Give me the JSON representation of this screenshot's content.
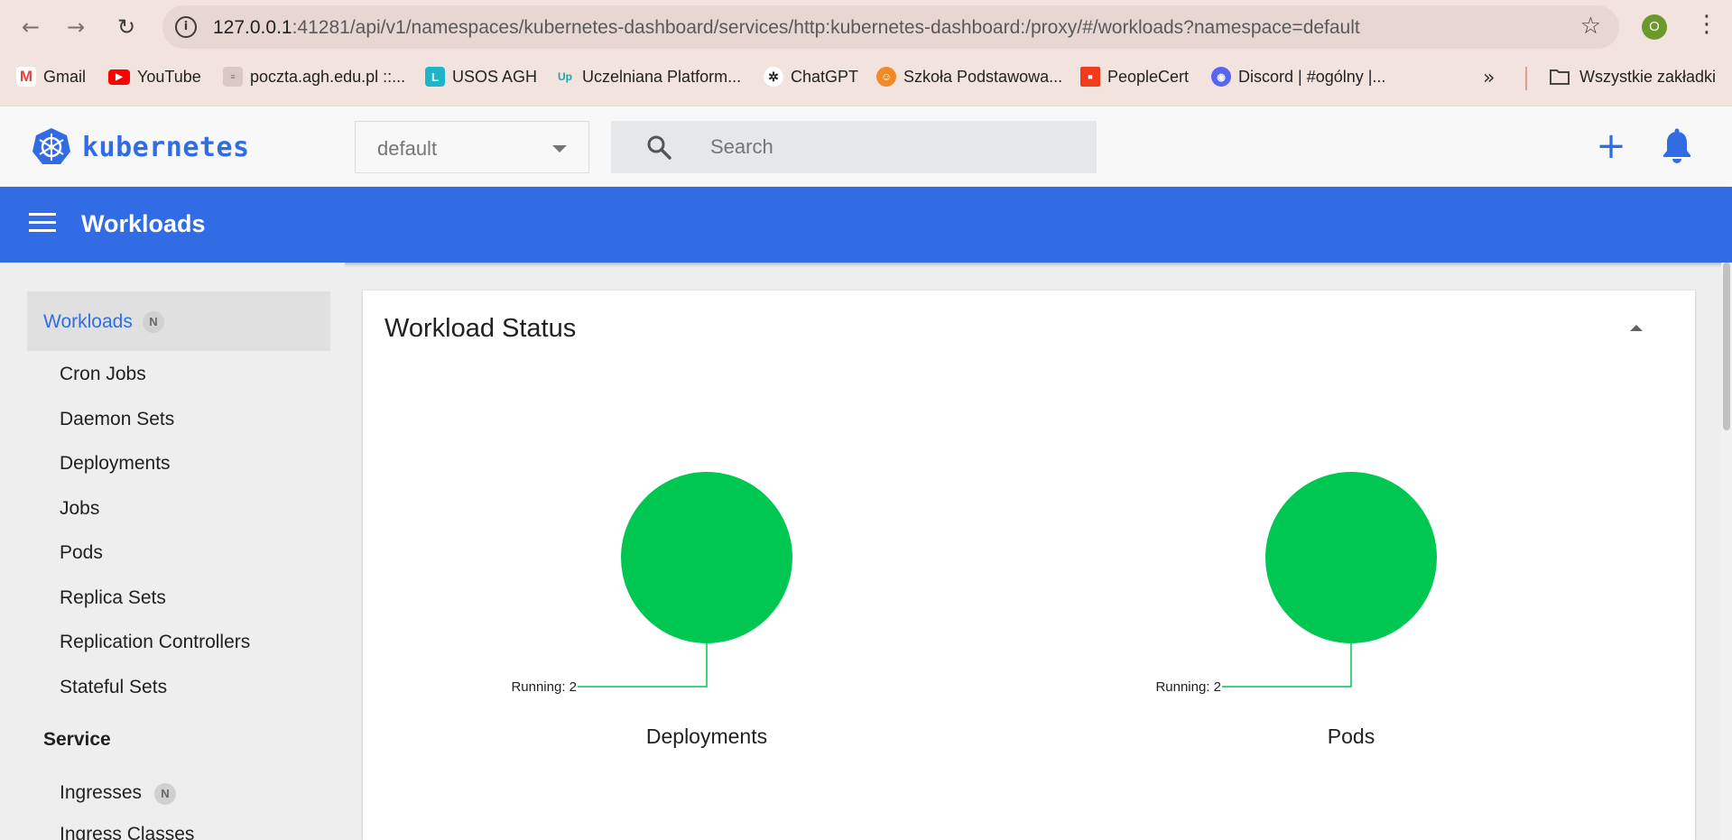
{
  "browser": {
    "url_host": "127.0.0.1",
    "url_rest": ":41281/api/v1/namespaces/kubernetes-dashboard/services/http:kubernetes-dashboard:/proxy/#/workloads?namespace=default",
    "profile_initial": "O",
    "bookmarks": [
      {
        "label": "Gmail",
        "icon": "gmail-icon",
        "color": "#ea4335"
      },
      {
        "label": "YouTube",
        "icon": "youtube-icon",
        "color": "#ff0000"
      },
      {
        "label": "poczta.agh.edu.pl ::...",
        "icon": "agh-mail-icon",
        "color": "#888888"
      },
      {
        "label": "USOS AGH",
        "icon": "usos-icon",
        "color": "#1fb5c9"
      },
      {
        "label": "Uczelniana Platform...",
        "icon": "upel-icon",
        "color": "#1aa6a6"
      },
      {
        "label": "ChatGPT",
        "icon": "chatgpt-icon",
        "color": "#222222"
      },
      {
        "label": "Szkoła Podstawowa...",
        "icon": "school-icon",
        "color": "#f08a24"
      },
      {
        "label": "PeopleCert",
        "icon": "peoplecert-icon",
        "color": "#f03c1e"
      },
      {
        "label": "Discord | #ogólny |...",
        "icon": "discord-icon",
        "color": "#5865f2"
      }
    ],
    "all_bookmarks_label": "Wszystkie zakładki"
  },
  "header": {
    "brand": "kubernetes",
    "namespace": "default",
    "search_placeholder": "Search"
  },
  "toolbar": {
    "title": "Workloads"
  },
  "sidebar": {
    "active": {
      "label": "Workloads",
      "badge": "N"
    },
    "items": [
      "Cron Jobs",
      "Daemon Sets",
      "Deployments",
      "Jobs",
      "Pods",
      "Replica Sets",
      "Replication Controllers",
      "Stateful Sets"
    ],
    "section_service": "Service",
    "service_items": [
      {
        "label": "Ingresses",
        "badge": "N"
      },
      {
        "label": "Ingress Classes"
      }
    ]
  },
  "card": {
    "title": "Workload Status"
  },
  "chart_data": [
    {
      "type": "pie",
      "title": "Deployments",
      "slices": [
        {
          "label": "Running",
          "value": 2,
          "color": "#00c752"
        }
      ],
      "slice_label": "Running: 2"
    },
    {
      "type": "pie",
      "title": "Pods",
      "slices": [
        {
          "label": "Running",
          "value": 2,
          "color": "#00c752"
        }
      ],
      "slice_label": "Running: 2"
    }
  ],
  "colors": {
    "accent": "#326ce5",
    "running": "#00c752"
  }
}
